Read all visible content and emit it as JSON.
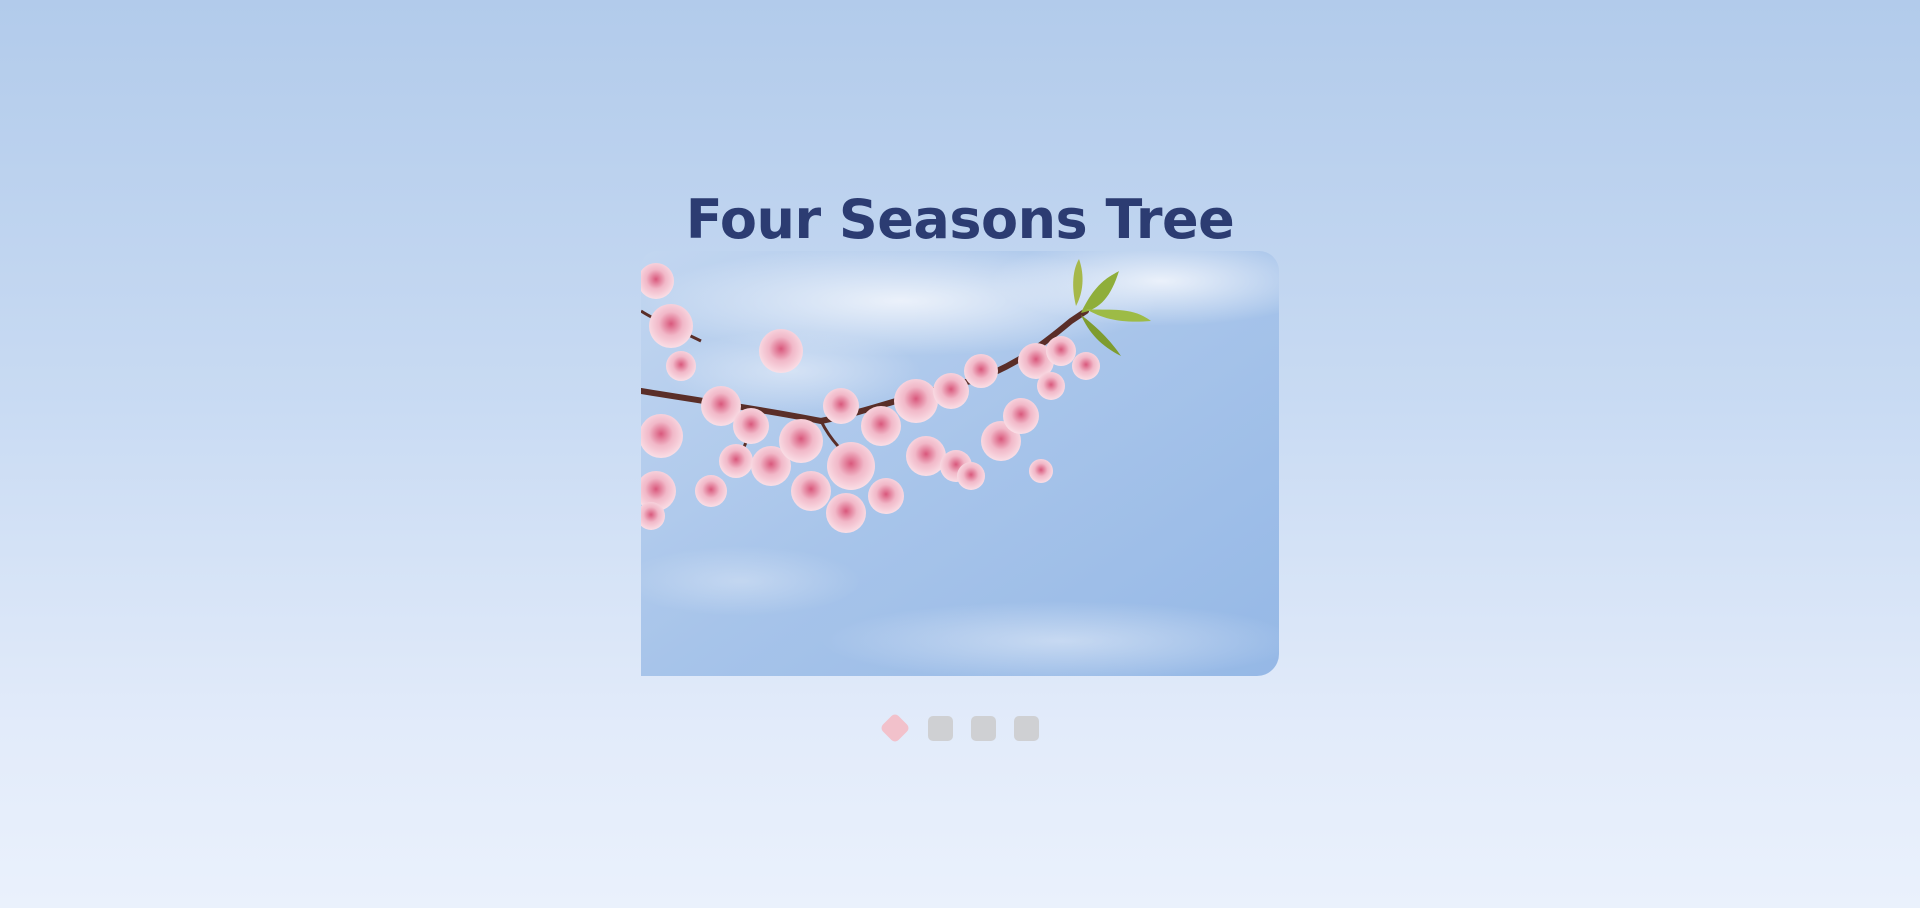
{
  "page": {
    "title": "Four Seasons Tree"
  },
  "carousel": {
    "slides": [
      {
        "image_icon": "cherry-blossom-image"
      }
    ],
    "active_index": 0,
    "dot_count": 4,
    "colors": {
      "active_dot": "#f2c1cb",
      "inactive_dot": "#cfd0d3",
      "title": "#2c3c72"
    }
  }
}
